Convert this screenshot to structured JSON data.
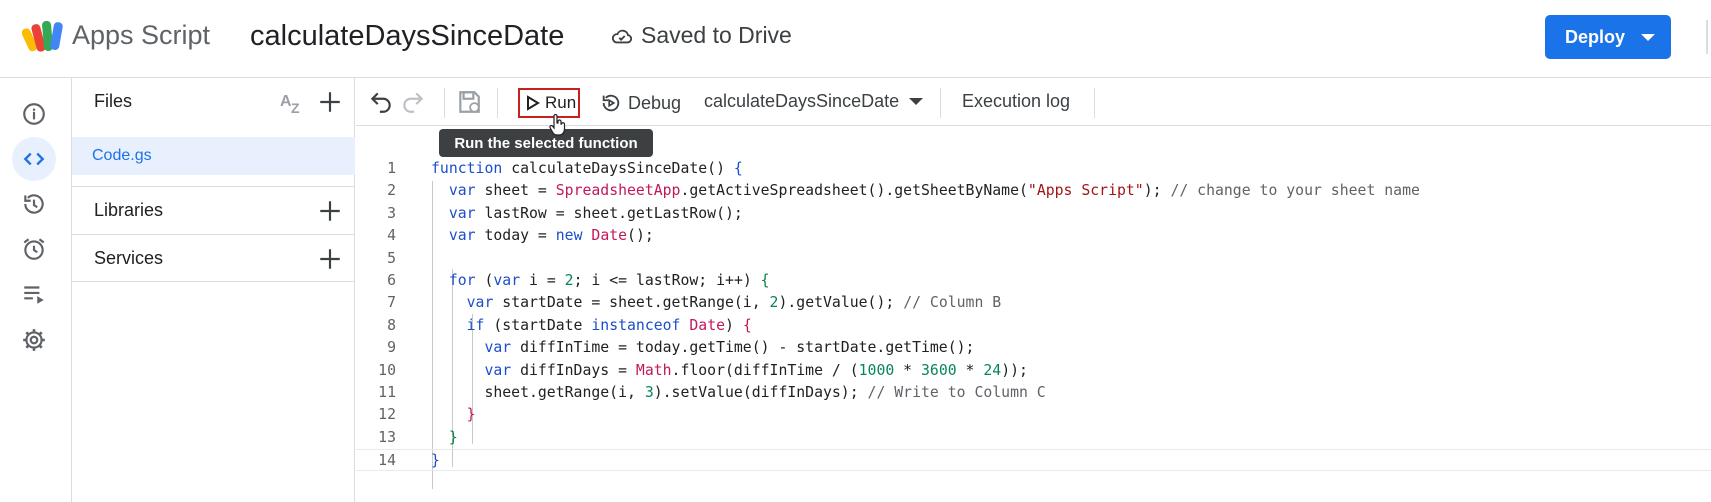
{
  "header": {
    "app_name": "Apps Script",
    "project_title": "calculateDaysSinceDate",
    "save_status": "Saved to Drive",
    "deploy_label": "Deploy"
  },
  "rail": {
    "items": [
      {
        "icon": "info-icon",
        "label": "Overview"
      },
      {
        "icon": "code-icon",
        "label": "Editor",
        "active": true
      },
      {
        "icon": "history-icon",
        "label": "Project History"
      },
      {
        "icon": "alarm-icon",
        "label": "Triggers"
      },
      {
        "icon": "executions-icon",
        "label": "Executions"
      },
      {
        "icon": "gear-icon",
        "label": "Project Settings"
      }
    ]
  },
  "files_panel": {
    "title": "Files",
    "files": [
      {
        "name": "Code.gs"
      }
    ],
    "sections": [
      "Libraries",
      "Services"
    ]
  },
  "toolbar": {
    "run_label": "Run",
    "debug_label": "Debug",
    "selected_function": "calculateDaysSinceDate",
    "execution_log_label": "Execution log",
    "run_tooltip": "Run the selected function"
  },
  "code": {
    "line_numbers": [
      "1",
      "2",
      "3",
      "4",
      "5",
      "6",
      "7",
      "8",
      "9",
      "10",
      "11",
      "12",
      "13",
      "14"
    ]
  },
  "colors": {
    "accent": "#1a73e8",
    "run_highlight": "#c5221f",
    "selected_bg": "#e8f0fe"
  }
}
